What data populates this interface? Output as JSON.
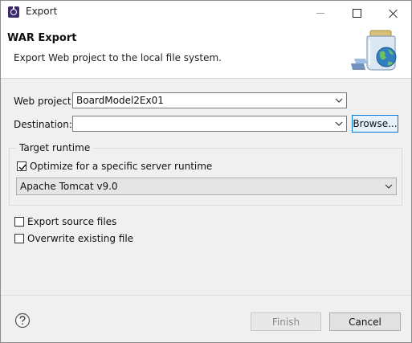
{
  "window": {
    "title": "Export"
  },
  "header": {
    "title": "WAR Export",
    "description": "Export Web project to the local file system."
  },
  "form": {
    "web_project_label": "Web project:",
    "web_project_value": "BoardModel2Ex01",
    "destination_label": "Destination:",
    "destination_value": "",
    "browse_label": "Browse..."
  },
  "target_runtime": {
    "group_title": "Target runtime",
    "optimize_label": "Optimize for a specific server runtime",
    "optimize_checked": true,
    "runtime_value": "Apache Tomcat v9.0"
  },
  "options": {
    "export_source_label": "Export source files",
    "export_source_checked": false,
    "overwrite_label": "Overwrite existing file",
    "overwrite_checked": false
  },
  "footer": {
    "finish_label": "Finish",
    "cancel_label": "Cancel"
  },
  "icons": {
    "app": "eclipse-icon",
    "help": "help-icon",
    "wizard": "war-export-wizard-icon",
    "minimize": "minimize-icon",
    "maximize": "maximize-icon",
    "close": "close-icon"
  }
}
